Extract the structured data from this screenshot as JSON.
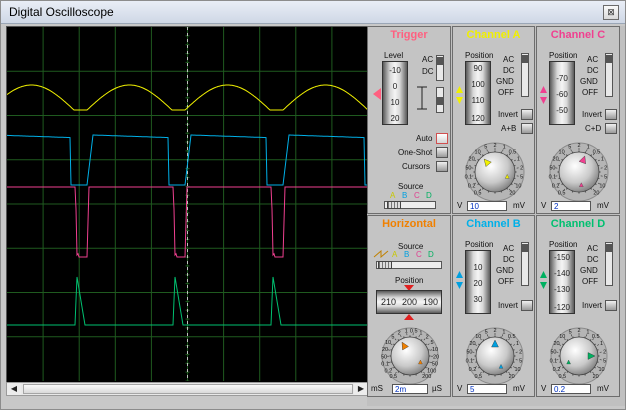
{
  "window": {
    "title": "Digital Oscilloscope",
    "close_glyph": "⊠"
  },
  "colors": {
    "channel_a": "#f0f000",
    "channel_b": "#00b0e8",
    "channel_c": "#f04090",
    "channel_d": "#00c070",
    "trigger": "#ff6080",
    "horizontal": "#f08000",
    "screen_bg": "#000000",
    "grid": "#1f5a1f"
  },
  "trigger": {
    "title": "Trigger",
    "level_label": "Level",
    "level_scale": [
      "-10",
      "0",
      "10",
      "20"
    ],
    "modes": [
      "AC",
      "DC"
    ],
    "auto_label": "Auto",
    "oneshot_label": "One-Shot",
    "cursors_label": "Cursors",
    "source_label": "Source",
    "source_letters": [
      "A",
      "B",
      "C",
      "D"
    ]
  },
  "channel_a": {
    "title": "Channel A",
    "position_label": "Position",
    "position_scale": [
      "90",
      "100",
      "110",
      "120"
    ],
    "couplings": [
      "AC",
      "DC",
      "GND",
      "OFF"
    ],
    "invert_label": "Invert",
    "combine_label": "A+B",
    "knob_scale": [
      "0.5",
      "0.2",
      "0.1",
      "50",
      "20",
      "10",
      "5",
      "2",
      "1",
      "0.5",
      "1",
      "2",
      "5",
      "10",
      "20"
    ],
    "volts_label": "V",
    "millivolts_label": "mV",
    "value": "10",
    "unit": "mV"
  },
  "channel_c": {
    "title": "Channel C",
    "position_label": "Position",
    "position_scale": [
      "-70",
      "-60",
      "-50"
    ],
    "couplings": [
      "AC",
      "DC",
      "GND",
      "OFF"
    ],
    "invert_label": "Invert",
    "combine_label": "C+D",
    "knob_scale": [
      "0.5",
      "0.2",
      "0.1",
      "50",
      "20",
      "10",
      "5",
      "2",
      "1",
      "0.5",
      "1",
      "2",
      "5",
      "10",
      "20"
    ],
    "volts_label": "V",
    "millivolts_label": "mV",
    "value": "2",
    "unit": "mV"
  },
  "horizontal": {
    "title": "Horizontal",
    "source_label": "Source",
    "source_letters": [
      "A",
      "B",
      "C",
      "D"
    ],
    "position_label": "Position",
    "position_scale": [
      "210",
      "200",
      "190"
    ],
    "knob_scale": [
      "0.5",
      "0.2",
      "0.1",
      "50",
      "20",
      "10",
      "5",
      "2",
      "1",
      "0.5",
      "1",
      "2",
      "5",
      "10",
      "20",
      "50",
      "100",
      "200"
    ],
    "ms_label": "mS",
    "us_label": "µS",
    "value": "2m"
  },
  "channel_b": {
    "title": "Channel B",
    "position_label": "Position",
    "position_scale": [
      "10",
      "20",
      "30"
    ],
    "couplings": [
      "AC",
      "DC",
      "GND",
      "OFF"
    ],
    "invert_label": "Invert",
    "knob_scale": [
      "0.5",
      "0.2",
      "0.1",
      "50",
      "20",
      "10",
      "5",
      "2",
      "1",
      "0.5",
      "1",
      "2",
      "5",
      "10",
      "20"
    ],
    "volts_label": "V",
    "millivolts_label": "mV",
    "value": "5",
    "unit": "mV"
  },
  "channel_d": {
    "title": "Channel D",
    "position_label": "Position",
    "position_scale": [
      "-150",
      "-140",
      "-130",
      "-120"
    ],
    "couplings": [
      "AC",
      "DC",
      "GND",
      "OFF"
    ],
    "invert_label": "Invert",
    "knob_scale": [
      "0.5",
      "0.2",
      "0.1",
      "50",
      "20",
      "10",
      "5",
      "2",
      "1",
      "0.5",
      "1",
      "2",
      "5",
      "10",
      "20"
    ],
    "volts_label": "V",
    "millivolts_label": "mV",
    "value": "0.2",
    "unit": "mV"
  },
  "scrollbar": {
    "left_glyph": "◀",
    "right_glyph": "▶"
  }
}
